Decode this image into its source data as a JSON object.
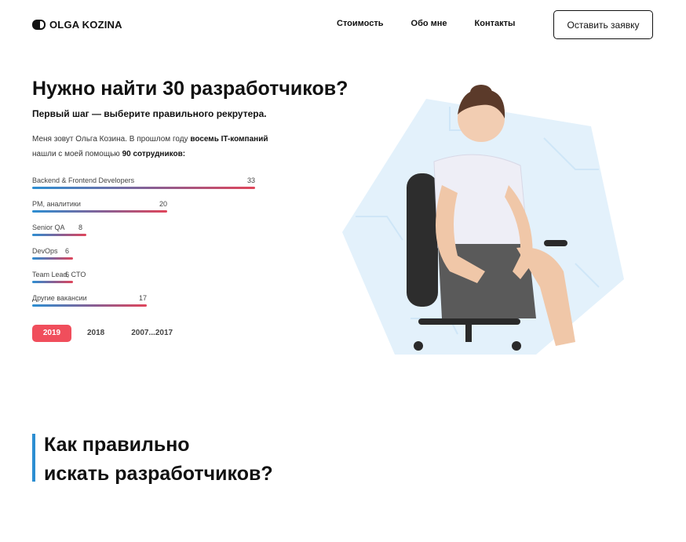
{
  "header": {
    "logo_text": "OLGA KOZINA",
    "nav": [
      "Стоимость",
      "Обо мне",
      "Контакты"
    ],
    "cta_label": "Оставить заявку"
  },
  "hero": {
    "title": "Нужно найти 30 разработчиков?",
    "subtitle": "Первый шаг — выберите правильного рекрутера.",
    "intro_part1": "Меня зовут Ольга Козина. В прошлом году ",
    "intro_bold1": "восемь IT-компаний",
    "intro_part2": " нашли с моей помощью ",
    "intro_bold2": "90 сотрудников:",
    "stats": [
      {
        "label": "Backend & Frontend Developers",
        "value": 33
      },
      {
        "label": "PM, аналитики",
        "value": 20
      },
      {
        "label": "Senior QA",
        "value": 8
      },
      {
        "label": "DevOps",
        "value": 6
      },
      {
        "label": "Team Lead, CTO",
        "value": 6
      },
      {
        "label": "Другие вакансии",
        "value": 17
      }
    ],
    "years": [
      "2019",
      "2018",
      "2007...2017"
    ],
    "active_year": "2019"
  },
  "section2": {
    "title_line1": "Как правильно",
    "title_line2": "искать разработчиков?"
  },
  "colors": {
    "accent_red": "#f04e5c",
    "accent_blue": "#2c8ed2",
    "hexagon_bg": "#e3f1fb"
  }
}
